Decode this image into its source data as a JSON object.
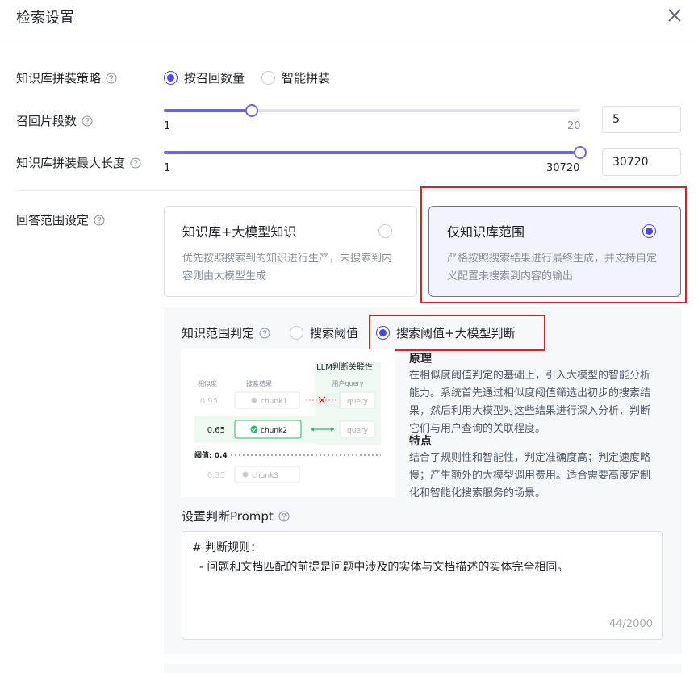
{
  "dialog": {
    "title": "检索设置"
  },
  "strategy": {
    "label": "知识库拼装策略",
    "options": [
      {
        "label": "按召回数量",
        "selected": true
      },
      {
        "label": "智能拼装",
        "selected": false
      }
    ]
  },
  "chunks": {
    "label": "召回片段数",
    "min_label": "1",
    "max_label": "20",
    "min": 1,
    "max": 20,
    "value": 5,
    "input_value": "5"
  },
  "max_length": {
    "label": "知识库拼装最大长度",
    "min_label": "1",
    "max_label": "30720",
    "min": 1,
    "max": 30720,
    "value": 30720,
    "input_value": "30720"
  },
  "answer_scope": {
    "label": "回答范围设定",
    "cards": [
      {
        "title": "知识库+大模型知识",
        "desc_line1": "优先按照搜索到的知识进行生产，未搜索到内",
        "desc_line2": "容则由大模型生成",
        "selected": false
      },
      {
        "title": "仅知识库范围",
        "desc_line1": "严格按照搜索结果进行最终生成，并支持自定",
        "desc_line2": "义配置未搜索到内容的输出",
        "selected": true
      }
    ]
  },
  "judge": {
    "label": "知识范围判定",
    "options": [
      {
        "label": "搜索阈值",
        "selected": false
      },
      {
        "label": "搜索阈值+大模型判断",
        "selected": true
      }
    ]
  },
  "diagram": {
    "title": "LLM判断关联性",
    "col_similarity": "相似度",
    "col_result": "搜索结果",
    "col_query": "用户query",
    "rows": [
      {
        "score": "0.95",
        "chunk": "chunk1",
        "query": "query"
      },
      {
        "score": "0.65",
        "chunk": "chunk2",
        "query": "query"
      },
      {
        "score": "0.35",
        "chunk": "chunk3"
      }
    ],
    "threshold": "阈值: 0.4"
  },
  "principle": {
    "title": "原理",
    "lines": [
      "在相似度阈值判定的基础上，引入大模型的智能分析",
      "能力。系统首先通过相似度阈值筛选出初步的搜索结",
      "果，然后利用大模型对这些结果进行深入分析，判断",
      "它们与用户查询的关联程度。"
    ]
  },
  "features": {
    "title": "特点",
    "lines": [
      "结合了规则性和智能性，判定准确度高；判定速度略",
      "慢；产生额外的大模型调用费用。适合需要高度定制",
      "化和智能化搜索服务的场景。"
    ]
  },
  "prompt": {
    "label": "设置判断Prompt",
    "line1": "# 判断规则：",
    "line2": "  - 问题和文档匹配的前提是问题中涉及的实体与文档描述的实体完全相同。",
    "counter": "44/2000"
  },
  "colors": {
    "accent": "#6c63ff",
    "highlight": "#e02020"
  }
}
